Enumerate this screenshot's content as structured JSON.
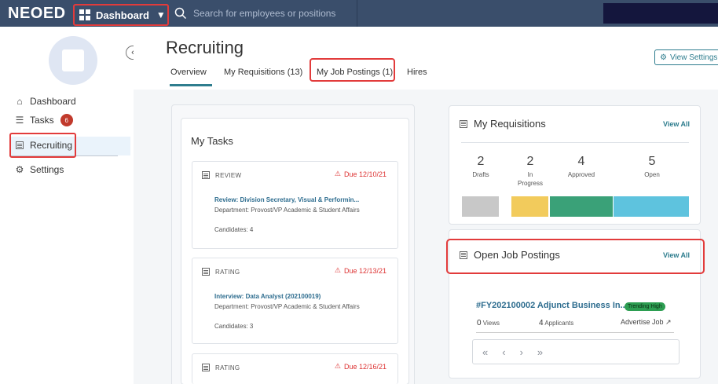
{
  "topbar": {
    "logo": "NEOED",
    "dashboard_label": "Dashboard",
    "search_placeholder": "Search for employees or positions"
  },
  "sidebar": {
    "items": [
      {
        "label": "Dashboard",
        "icon": "home-icon"
      },
      {
        "label": "Tasks",
        "icon": "list-icon",
        "badge": "6"
      },
      {
        "label": "Recruiting",
        "icon": "document-icon"
      },
      {
        "label": "Settings",
        "icon": "gear-icon"
      }
    ]
  },
  "header": {
    "title": "Recruiting",
    "tabs": [
      "Overview",
      "My Requisitions (13)",
      "My Job Postings (1)",
      "Hires"
    ],
    "view_settings": "View Settings"
  },
  "my_tasks": {
    "title": "My Tasks",
    "tasks": [
      {
        "type": "REVIEW",
        "due": "Due 12/10/21",
        "title": "Review: Division Secretary, Visual & Performin...",
        "department": "Department: Provost/VP Academic & Student Affairs",
        "candidates": "Candidates: 4"
      },
      {
        "type": "RATING",
        "due": "Due 12/13/21",
        "title": "Interview: Data Analyst (202100019)",
        "department": "Department: Provost/VP Academic & Student Affairs",
        "candidates": "Candidates: 3"
      },
      {
        "type": "RATING",
        "due": "Due 12/16/21"
      }
    ]
  },
  "requisitions": {
    "title": "My Requisitions",
    "view_all": "View All",
    "stats": [
      {
        "value": "2",
        "label": "Drafts",
        "color": "#c8c8c8"
      },
      {
        "value": "2",
        "label": "In Progress",
        "color": "#f2cb5c"
      },
      {
        "value": "4",
        "label": "Approved",
        "color": "#3aa178"
      },
      {
        "value": "5",
        "label": "Open",
        "color": "#5ec3de"
      }
    ]
  },
  "job_postings": {
    "title": "Open Job Postings",
    "view_all": "View All",
    "posting_title": "#FY202100002 Adjunct Business In...",
    "tag": "Trending High",
    "views": "0",
    "views_label": "Views",
    "applicants": "4",
    "applicants_label": "Applicants",
    "advertise": "Advertise Job ↗"
  },
  "colors": {
    "topbar": "#3a4e6b",
    "accent": "#2e7d8e",
    "highlight": "#e23b3b"
  }
}
